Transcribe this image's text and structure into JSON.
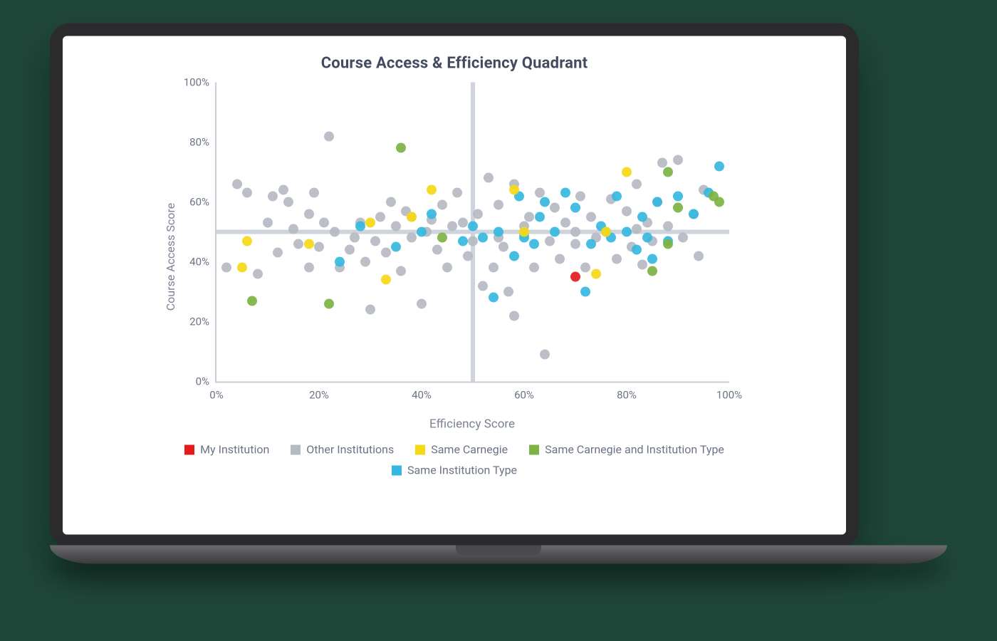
{
  "chart_data": {
    "type": "scatter",
    "title": "Course Access & Efficiency Quadrant",
    "xlabel": "Efficiency Score",
    "ylabel": "Course Access Score",
    "xlim": [
      0,
      100
    ],
    "ylim": [
      0,
      100
    ],
    "xticks": [
      "0%",
      "20%",
      "40%",
      "60%",
      "80%",
      "100%"
    ],
    "yticks": [
      "0%",
      "20%",
      "40%",
      "60%",
      "80%",
      "100%"
    ],
    "quadrant_lines": {
      "x": 50,
      "y": 50
    },
    "legend": [
      {
        "name": "My Institution",
        "color": "#e31b1b"
      },
      {
        "name": "Other Institutions",
        "color": "#b6bac3"
      },
      {
        "name": "Same Carnegie",
        "color": "#f5d916"
      },
      {
        "name": "Same Carnegie and Institution Type",
        "color": "#7cb342"
      },
      {
        "name": "Same Institution Type",
        "color": "#35b8e0"
      }
    ],
    "series": [
      {
        "name": "Other Institutions",
        "color": "#b6bac3",
        "points": [
          [
            2,
            38
          ],
          [
            4,
            66
          ],
          [
            6,
            63
          ],
          [
            8,
            36
          ],
          [
            10,
            53
          ],
          [
            11,
            62
          ],
          [
            12,
            43
          ],
          [
            13,
            64
          ],
          [
            14,
            60
          ],
          [
            15,
            51
          ],
          [
            16,
            46
          ],
          [
            18,
            56
          ],
          [
            18,
            38
          ],
          [
            19,
            63
          ],
          [
            20,
            45
          ],
          [
            21,
            53
          ],
          [
            22,
            82
          ],
          [
            23,
            50
          ],
          [
            24,
            38
          ],
          [
            26,
            44
          ],
          [
            27,
            48
          ],
          [
            28,
            53
          ],
          [
            29,
            40
          ],
          [
            30,
            24
          ],
          [
            31,
            47
          ],
          [
            32,
            55
          ],
          [
            33,
            43
          ],
          [
            34,
            60
          ],
          [
            35,
            52
          ],
          [
            36,
            37
          ],
          [
            37,
            57
          ],
          [
            38,
            48
          ],
          [
            40,
            26
          ],
          [
            41,
            50
          ],
          [
            42,
            54
          ],
          [
            43,
            44
          ],
          [
            44,
            59
          ],
          [
            45,
            38
          ],
          [
            46,
            52
          ],
          [
            47,
            63
          ],
          [
            48,
            53
          ],
          [
            49,
            42
          ],
          [
            50,
            47
          ],
          [
            51,
            56
          ],
          [
            52,
            32
          ],
          [
            53,
            68
          ],
          [
            54,
            38
          ],
          [
            55,
            59
          ],
          [
            56,
            45
          ],
          [
            57,
            30
          ],
          [
            58,
            66
          ],
          [
            58,
            22
          ],
          [
            60,
            49
          ],
          [
            61,
            55
          ],
          [
            62,
            38
          ],
          [
            63,
            63
          ],
          [
            64,
            9
          ],
          [
            65,
            47
          ],
          [
            66,
            58
          ],
          [
            67,
            41
          ],
          [
            68,
            53
          ],
          [
            70,
            46
          ],
          [
            71,
            62
          ],
          [
            72,
            38
          ],
          [
            73,
            55
          ],
          [
            74,
            48
          ],
          [
            76,
            50
          ],
          [
            77,
            61
          ],
          [
            78,
            41
          ],
          [
            80,
            57
          ],
          [
            81,
            45
          ],
          [
            82,
            66
          ],
          [
            83,
            39
          ],
          [
            84,
            53
          ],
          [
            85,
            47
          ],
          [
            86,
            60
          ],
          [
            87,
            73
          ],
          [
            88,
            52
          ],
          [
            90,
            74
          ],
          [
            91,
            48
          ],
          [
            93,
            56
          ],
          [
            94,
            42
          ],
          [
            95,
            64
          ],
          [
            82,
            51
          ],
          [
            70,
            50
          ],
          [
            60,
            52
          ],
          [
            55,
            48
          ],
          [
            38,
            55
          ]
        ]
      },
      {
        "name": "Same Institution Type",
        "color": "#35b8e0",
        "points": [
          [
            24,
            40
          ],
          [
            28,
            52
          ],
          [
            35,
            45
          ],
          [
            40,
            50
          ],
          [
            42,
            56
          ],
          [
            48,
            47
          ],
          [
            50,
            52
          ],
          [
            52,
            48
          ],
          [
            54,
            28
          ],
          [
            55,
            50
          ],
          [
            59,
            62
          ],
          [
            60,
            48
          ],
          [
            62,
            46
          ],
          [
            63,
            55
          ],
          [
            64,
            60
          ],
          [
            68,
            63
          ],
          [
            70,
            58
          ],
          [
            72,
            30
          ],
          [
            75,
            52
          ],
          [
            77,
            48
          ],
          [
            78,
            62
          ],
          [
            80,
            50
          ],
          [
            82,
            44
          ],
          [
            83,
            55
          ],
          [
            84,
            48
          ],
          [
            85,
            41
          ],
          [
            86,
            60
          ],
          [
            88,
            47
          ],
          [
            90,
            62
          ],
          [
            93,
            56
          ],
          [
            96,
            63
          ],
          [
            98,
            72
          ],
          [
            66,
            50
          ],
          [
            58,
            42
          ],
          [
            73,
            46
          ]
        ]
      },
      {
        "name": "Same Carnegie",
        "color": "#f5d916",
        "points": [
          [
            5,
            38
          ],
          [
            6,
            47
          ],
          [
            18,
            46
          ],
          [
            30,
            53
          ],
          [
            33,
            34
          ],
          [
            38,
            55
          ],
          [
            42,
            64
          ],
          [
            58,
            64
          ],
          [
            60,
            50
          ],
          [
            74,
            36
          ],
          [
            76,
            50
          ],
          [
            80,
            70
          ]
        ]
      },
      {
        "name": "Same Carnegie and Institution Type",
        "color": "#7cb342",
        "points": [
          [
            7,
            27
          ],
          [
            22,
            26
          ],
          [
            36,
            78
          ],
          [
            44,
            48
          ],
          [
            85,
            37
          ],
          [
            88,
            70
          ],
          [
            88,
            46
          ],
          [
            90,
            58
          ],
          [
            97,
            62
          ],
          [
            98,
            60
          ]
        ]
      },
      {
        "name": "My Institution",
        "color": "#e31b1b",
        "points": [
          [
            70,
            35
          ]
        ]
      }
    ]
  }
}
